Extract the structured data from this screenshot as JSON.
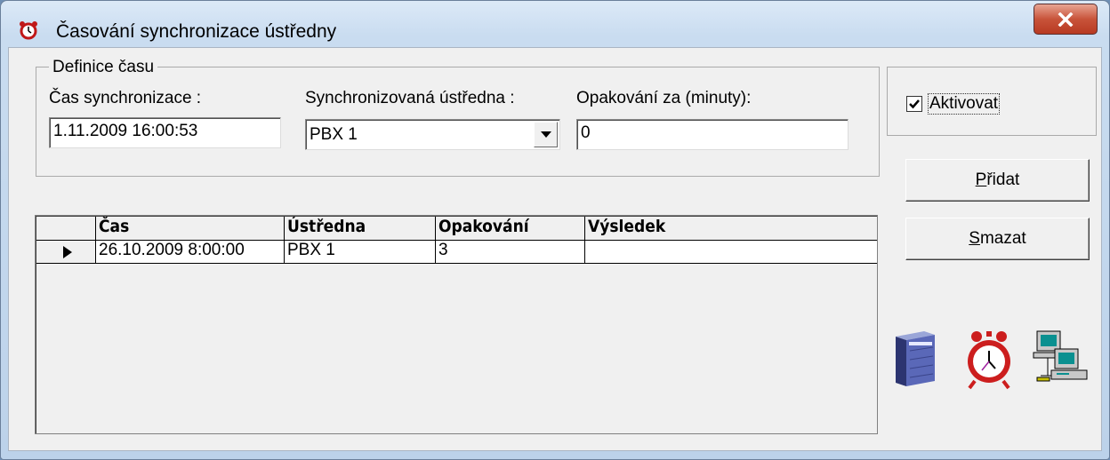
{
  "window": {
    "title": "Časování synchronizace ústředny",
    "close_label": "X"
  },
  "definition": {
    "group_label": "Definice času",
    "sync_time_label": "Čas synchronizace :",
    "sync_time_value": "1.11.2009 16:00:53",
    "pbx_label": "Synchronizovaná ústředna :",
    "pbx_value": "PBX 1",
    "repeat_label": "Opakování za (minuty):",
    "repeat_value": "0"
  },
  "activate": {
    "label": "Aktivovat",
    "checked": true
  },
  "buttons": {
    "add": {
      "prefix": "",
      "accel": "P",
      "rest": "řidat"
    },
    "delete": {
      "prefix": "",
      "accel": "S",
      "rest": "mazat"
    }
  },
  "grid": {
    "columns": [
      "Čas",
      "Ústředna",
      "Opakování",
      "Výsledek"
    ],
    "rows": [
      {
        "time": "26.10.2009 8:00:00",
        "pbx": "PBX 1",
        "repeat": "3",
        "result": ""
      }
    ]
  },
  "icons": [
    "pbx-unit-icon",
    "alarm-clock-icon",
    "network-computers-icon"
  ],
  "colors": {
    "close_button": "#c8533a",
    "alarm_red": "#cc1e1e"
  }
}
